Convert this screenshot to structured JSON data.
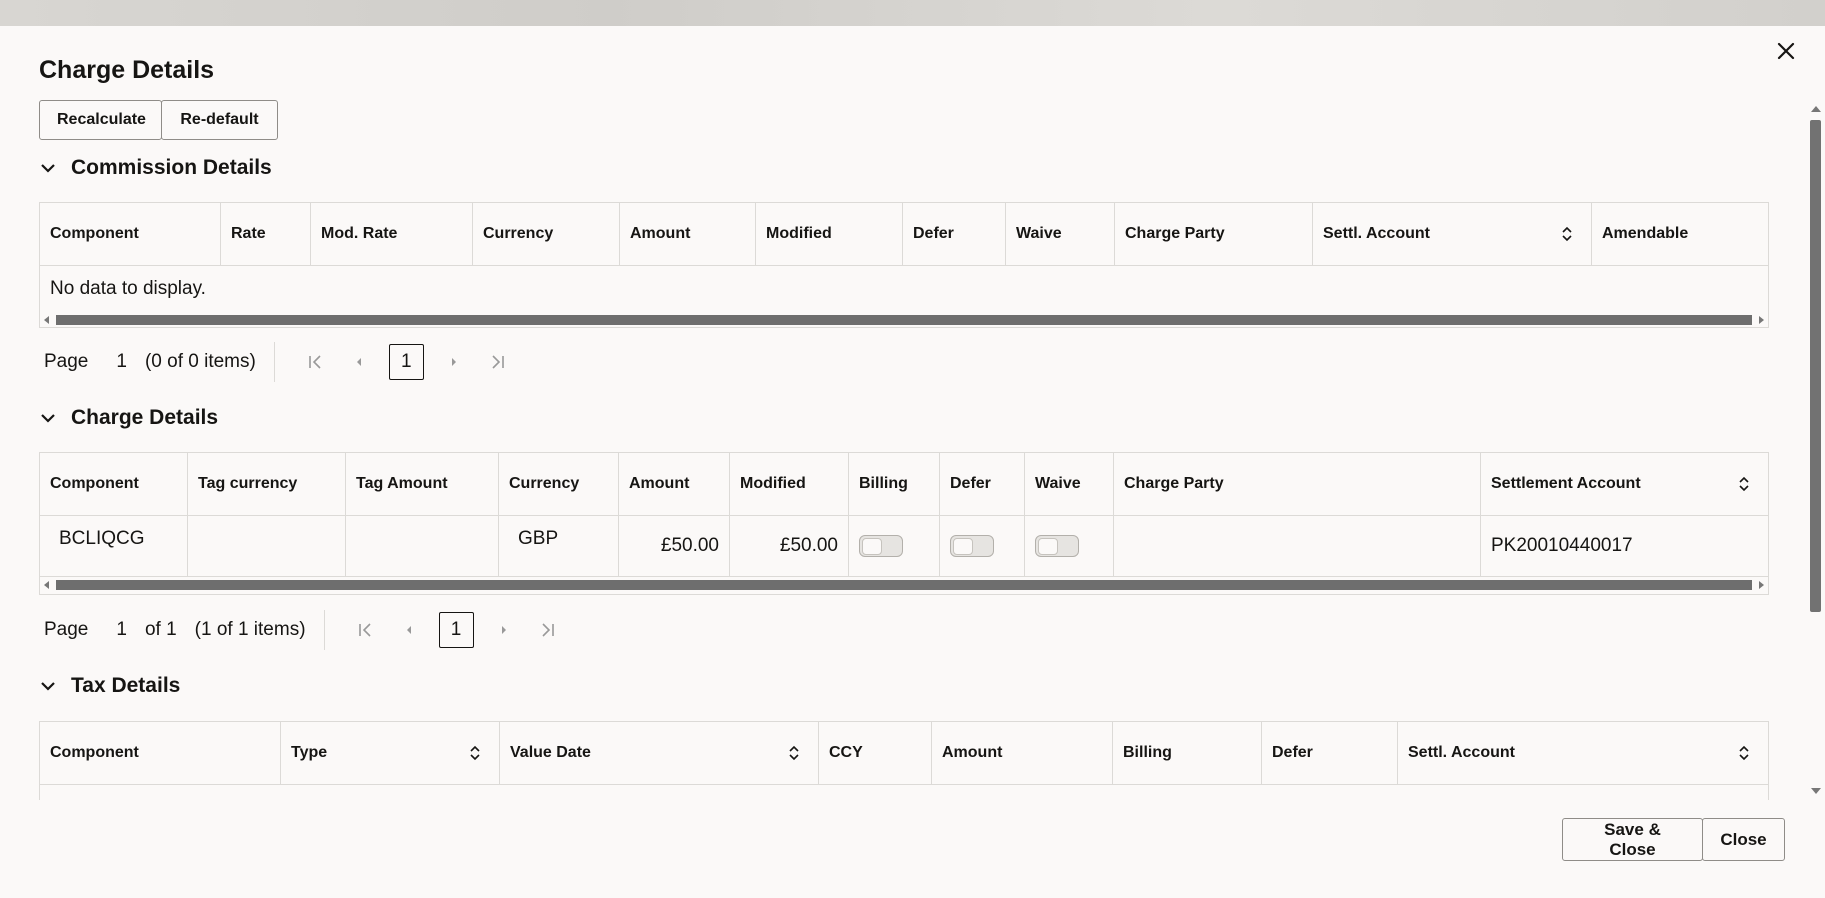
{
  "dialog": {
    "title": "Charge Details",
    "close_icon": "close-icon"
  },
  "toolbar": {
    "recalculate_label": "Recalculate",
    "redefault_label": "Re-default"
  },
  "commission": {
    "section_label": "Commission Details",
    "columns": [
      "Component",
      "Rate",
      "Mod. Rate",
      "Currency",
      "Amount",
      "Modified",
      "Defer",
      "Waive",
      "Charge Party",
      "Settl. Account",
      "Amendable"
    ],
    "empty_text": "No data to display.",
    "pager": {
      "label": "Page",
      "page": "1",
      "count": "(0 of 0 items)",
      "current": "1"
    }
  },
  "charges": {
    "section_label": "Charge Details",
    "columns": [
      "Component",
      "Tag currency",
      "Tag Amount",
      "Currency",
      "Amount",
      "Modified",
      "Billing",
      "Defer",
      "Waive",
      "Charge Party",
      "Settlement Account"
    ],
    "rows": [
      {
        "component": "BCLIQCG",
        "tag_currency": "",
        "tag_amount": "",
        "currency": "GBP",
        "amount": "£50.00",
        "modified": "£50.00",
        "billing": false,
        "defer": false,
        "waive": false,
        "charge_party": "",
        "settlement_account": "PK20010440017"
      }
    ],
    "pager": {
      "label": "Page",
      "page": "1",
      "of": "of 1",
      "count": "(1 of 1 items)",
      "current": "1"
    }
  },
  "tax": {
    "section_label": "Tax Details",
    "columns": [
      "Component",
      "Type",
      "Value Date",
      "CCY",
      "Amount",
      "Billing",
      "Defer",
      "Settl. Account"
    ]
  },
  "footer": {
    "save_close_label": "Save & Close",
    "close_label": "Close"
  }
}
